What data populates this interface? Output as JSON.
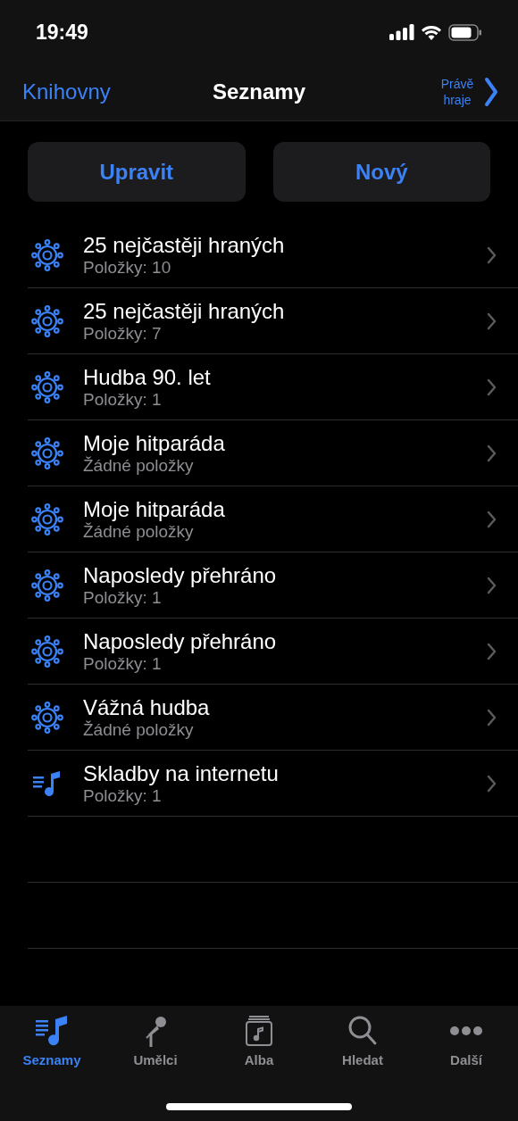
{
  "status_bar": {
    "time": "19:49"
  },
  "nav_bar": {
    "back": "Knihovny",
    "title": "Seznamy",
    "now_playing": "Právě hraje"
  },
  "buttons": [
    "Upravit",
    "Nový"
  ],
  "playlists": [
    {
      "kind": "smart",
      "title": "25 nejčastěji hraných",
      "subtitle": "Položky: 10"
    },
    {
      "kind": "smart",
      "title": "25 nejčastěji hraných",
      "subtitle": "Položky: 7"
    },
    {
      "kind": "smart",
      "title": "Hudba 90. let",
      "subtitle": "Položky: 1"
    },
    {
      "kind": "smart",
      "title": "Moje hitparáda",
      "subtitle": "Žádné položky"
    },
    {
      "kind": "smart",
      "title": "Moje hitparáda",
      "subtitle": "Žádné položky"
    },
    {
      "kind": "smart",
      "title": "Naposledy přehráno",
      "subtitle": "Položky: 1"
    },
    {
      "kind": "smart",
      "title": "Naposledy přehráno",
      "subtitle": "Položky: 1"
    },
    {
      "kind": "smart",
      "title": "Vážná hudba",
      "subtitle": "Žádné položky"
    },
    {
      "kind": "playlist",
      "title": "Skladby na internetu",
      "subtitle": "Položky: 1"
    }
  ],
  "tab_bar": [
    {
      "kind": "playlists",
      "label": "Seznamy",
      "selected": true
    },
    {
      "kind": "artists",
      "label": "Umělci",
      "selected": false
    },
    {
      "kind": "albums",
      "label": "Alba",
      "selected": false
    },
    {
      "kind": "search",
      "label": "Hledat",
      "selected": false
    },
    {
      "kind": "more",
      "label": "Další",
      "selected": false
    }
  ]
}
